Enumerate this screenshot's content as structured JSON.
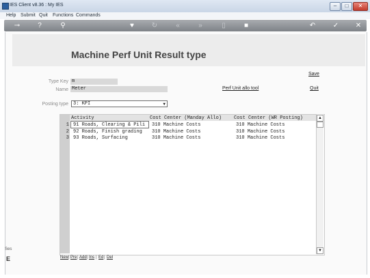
{
  "window": {
    "title": "IES Client v8.36 : My IES",
    "controls": [
      "–",
      "□",
      "✕"
    ]
  },
  "menubar": {
    "items": [
      "Help",
      "Submit",
      "Quit",
      "Functions",
      "Commands"
    ]
  },
  "toolbar": {
    "icons": [
      "key-icon",
      "help-icon",
      "search-icon",
      "heart-icon",
      "refresh-icon",
      "first-icon",
      "last-icon",
      "trash-icon",
      "stop-icon",
      "back-icon",
      "ok-icon",
      "close-icon"
    ]
  },
  "page": {
    "title": "Machine Perf Unit Result type",
    "links": {
      "save": "Save",
      "quit": "Quit",
      "tool": "Perf Unit allo tool"
    },
    "fields": {
      "type_key_label": "Type Key",
      "type_key_value": "m",
      "name_label": "Name",
      "name_value": "Meter",
      "posting_type_label": "Posting type",
      "posting_type_value": "3: KPI"
    }
  },
  "grid": {
    "columns": [
      "Activity",
      "Cost Center (Manday Allo)",
      "Cost Center (WR Posting)"
    ],
    "rows": [
      {
        "n": "1",
        "activity": "91 Roads, Clearing & Pili",
        "cc_manday": "310 Machine Costs",
        "cc_wr": "310 Machine Costs"
      },
      {
        "n": "2",
        "activity": "92 Roads, Finish grading",
        "cc_manday": "310 Machine Costs",
        "cc_wr": "310 Machine Costs"
      },
      {
        "n": "3",
        "activity": "93 Roads, Surfacing",
        "cc_manday": "310 Machine Costs",
        "cc_wr": "310 Machine Costs"
      }
    ],
    "buttons": [
      "New",
      "Pre",
      "Add",
      "Ins",
      "Ed",
      "Del"
    ]
  },
  "side_tab": {
    "label": "Ses"
  }
}
